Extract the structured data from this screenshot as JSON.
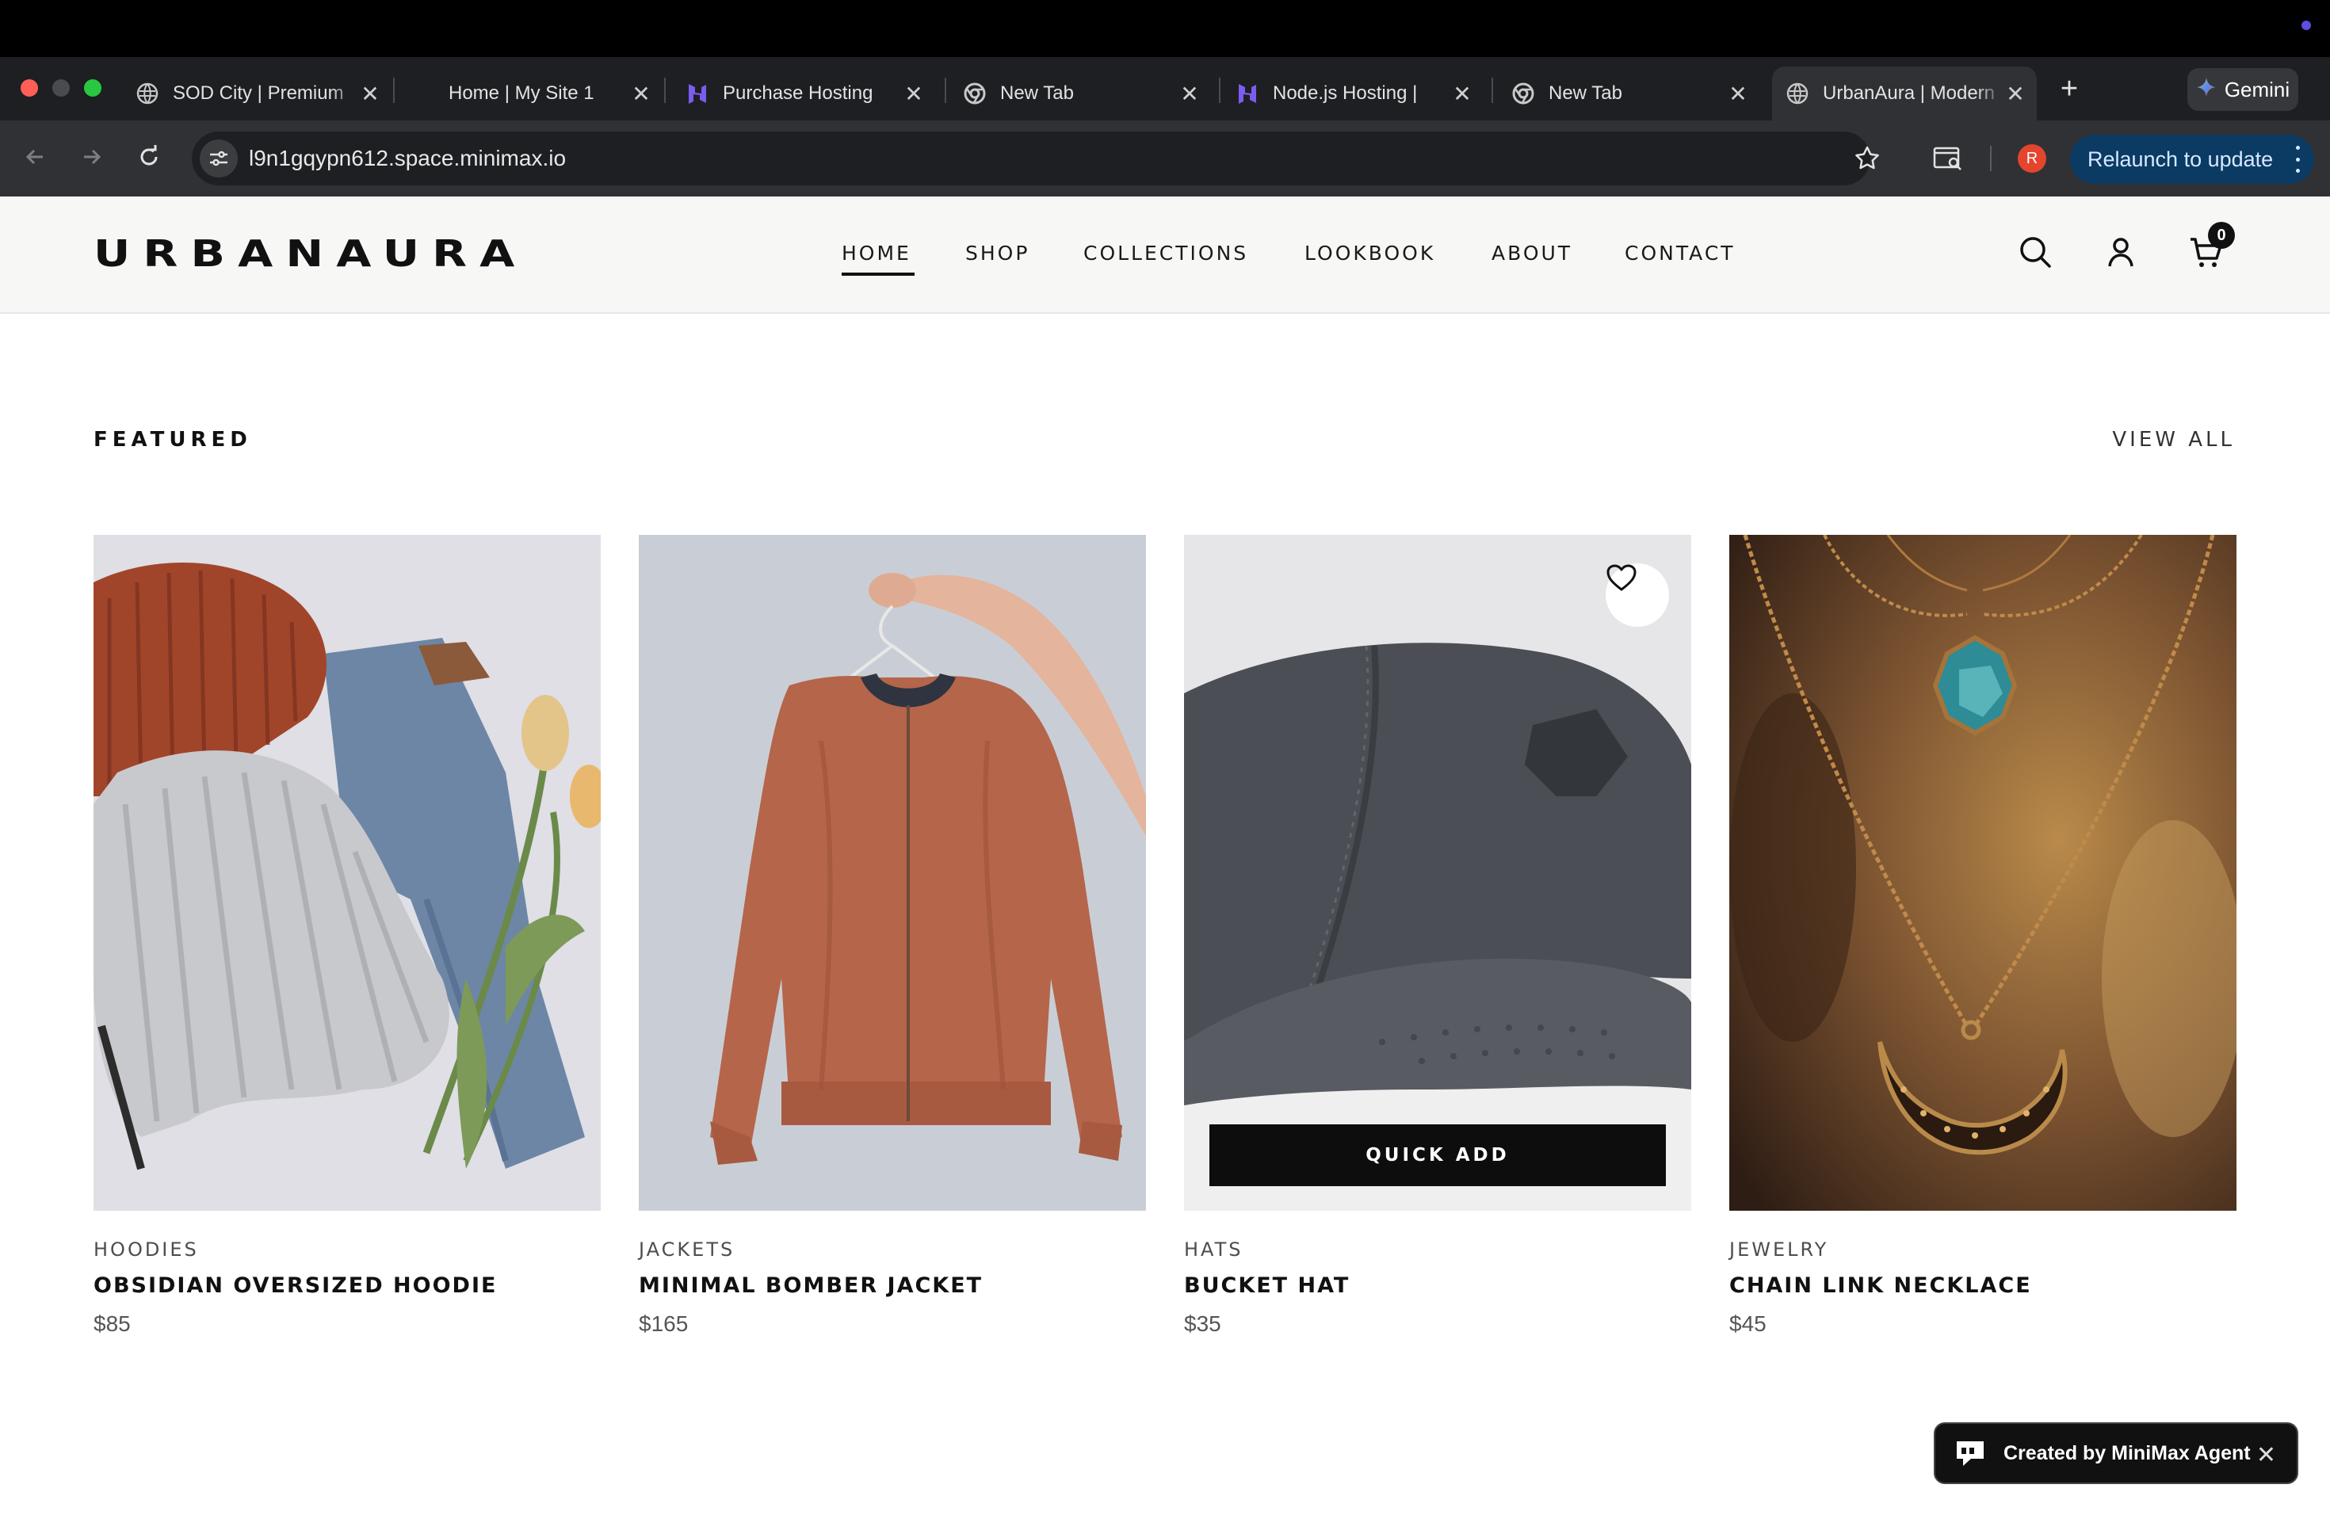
{
  "browser": {
    "tabs": [
      {
        "title": "SOD City | Premium",
        "icon": "globe-icon"
      },
      {
        "title": "Home | My Site 1",
        "icon": "blank"
      },
      {
        "title": "Purchase Hosting",
        "icon": "hostinger-icon"
      },
      {
        "title": "New Tab",
        "icon": "chrome-icon"
      },
      {
        "title": "Node.js Hosting | ",
        "icon": "hostinger-icon"
      },
      {
        "title": "New Tab",
        "icon": "chrome-icon"
      },
      {
        "title": "UrbanAura | Modern",
        "icon": "globe-icon",
        "active": true
      }
    ],
    "new_tab_label": "+",
    "close_glyph": "✕",
    "gemini_label": "Gemini",
    "url": "l9n1gqypn612.space.minimax.io",
    "profile_initial": "R",
    "relaunch_label": "Relaunch to update"
  },
  "site": {
    "logo": "URBANAURA",
    "nav": [
      {
        "label": "HOME",
        "active": true
      },
      {
        "label": "SHOP"
      },
      {
        "label": "COLLECTIONS"
      },
      {
        "label": "LOOKBOOK"
      },
      {
        "label": "ABOUT"
      },
      {
        "label": "CONTACT"
      }
    ],
    "cart_count": "0"
  },
  "featured": {
    "title": "FEATURED",
    "view_all": "VIEW ALL",
    "quick_add_label": "QUICK ADD",
    "products": [
      {
        "category": "HOODIES",
        "name": "OBSIDIAN OVERSIZED HOODIE",
        "price": "$85"
      },
      {
        "category": "JACKETS",
        "name": "MINIMAL BOMBER JACKET",
        "price": "$165"
      },
      {
        "category": "HATS",
        "name": "BUCKET HAT",
        "price": "$35"
      },
      {
        "category": "JEWELRY",
        "name": "CHAIN LINK NECKLACE",
        "price": "$45"
      }
    ]
  },
  "toast": {
    "label": "Created by MiniMax Agent",
    "close_glyph": "✕"
  },
  "colors": {
    "accent": "#111111",
    "browser_dark": "#1e1f22",
    "relaunch_bg": "#0b3a63",
    "profile": "#e3452f"
  }
}
